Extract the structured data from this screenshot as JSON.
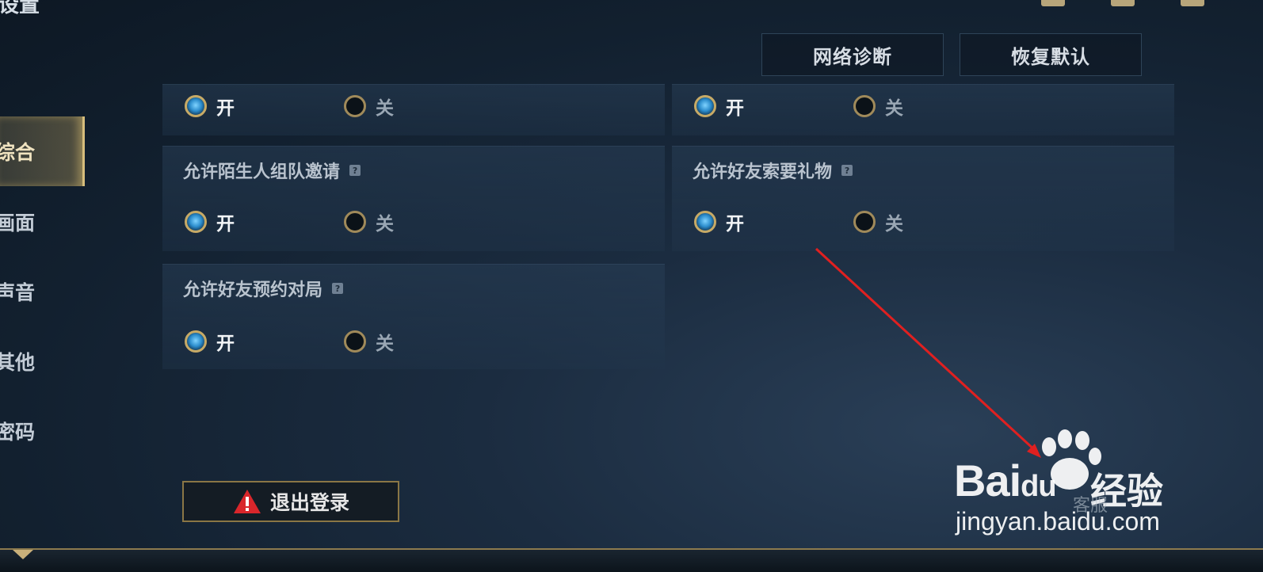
{
  "header": {
    "title": "设置"
  },
  "top_buttons": {
    "network": "网络诊断",
    "restore": "恢复默认"
  },
  "sidebar": {
    "items": [
      {
        "label": "综合",
        "active": true
      },
      {
        "label": "画面",
        "active": false
      },
      {
        "label": "声音",
        "active": false
      },
      {
        "label": "其他",
        "active": false
      },
      {
        "label": "密码",
        "active": false
      }
    ]
  },
  "options": {
    "on": "开",
    "off": "关",
    "help": "?"
  },
  "cards": [
    {
      "title": "",
      "selected": "开"
    },
    {
      "title": "",
      "selected": "开"
    },
    {
      "title": "允许陌生人组队邀请",
      "selected": "开"
    },
    {
      "title": "允许好友索要礼物",
      "selected": "开"
    },
    {
      "title": "允许好友预约对局",
      "selected": "开"
    }
  ],
  "logout": {
    "label": "退出登录"
  },
  "watermark": {
    "brand": "Bai",
    "brand2": "du",
    "cn": "经验",
    "url": "jingyan.baidu.com",
    "sub": "客服"
  },
  "colors": {
    "accent_gold": "#c7aa66",
    "radio_on": "#2b8ccc",
    "annotation_arrow": "#e02020"
  }
}
